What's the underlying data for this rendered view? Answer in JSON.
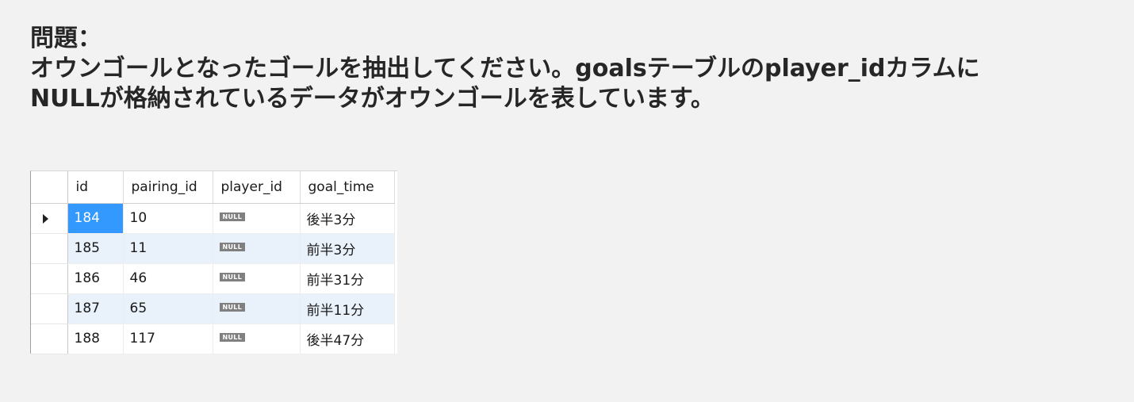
{
  "question": {
    "heading": "問題：",
    "line1": "オウンゴールとなったゴールを抽出してください。goalsテーブルのplayer_idカラムに",
    "line2": "NULLが格納されているデータがオウンゴールを表しています。"
  },
  "grid": {
    "columns": [
      "id",
      "pairing_id",
      "player_id",
      "goal_time"
    ],
    "null_label": "NULL",
    "rows": [
      {
        "id": "184",
        "pairing_id": "10",
        "goal_time": "後半3分"
      },
      {
        "id": "185",
        "pairing_id": "11",
        "goal_time": "前半3分"
      },
      {
        "id": "186",
        "pairing_id": "46",
        "goal_time": "前半31分"
      },
      {
        "id": "187",
        "pairing_id": "65",
        "goal_time": "前半11分"
      },
      {
        "id": "188",
        "pairing_id": "117",
        "goal_time": "後半47分"
      }
    ]
  }
}
